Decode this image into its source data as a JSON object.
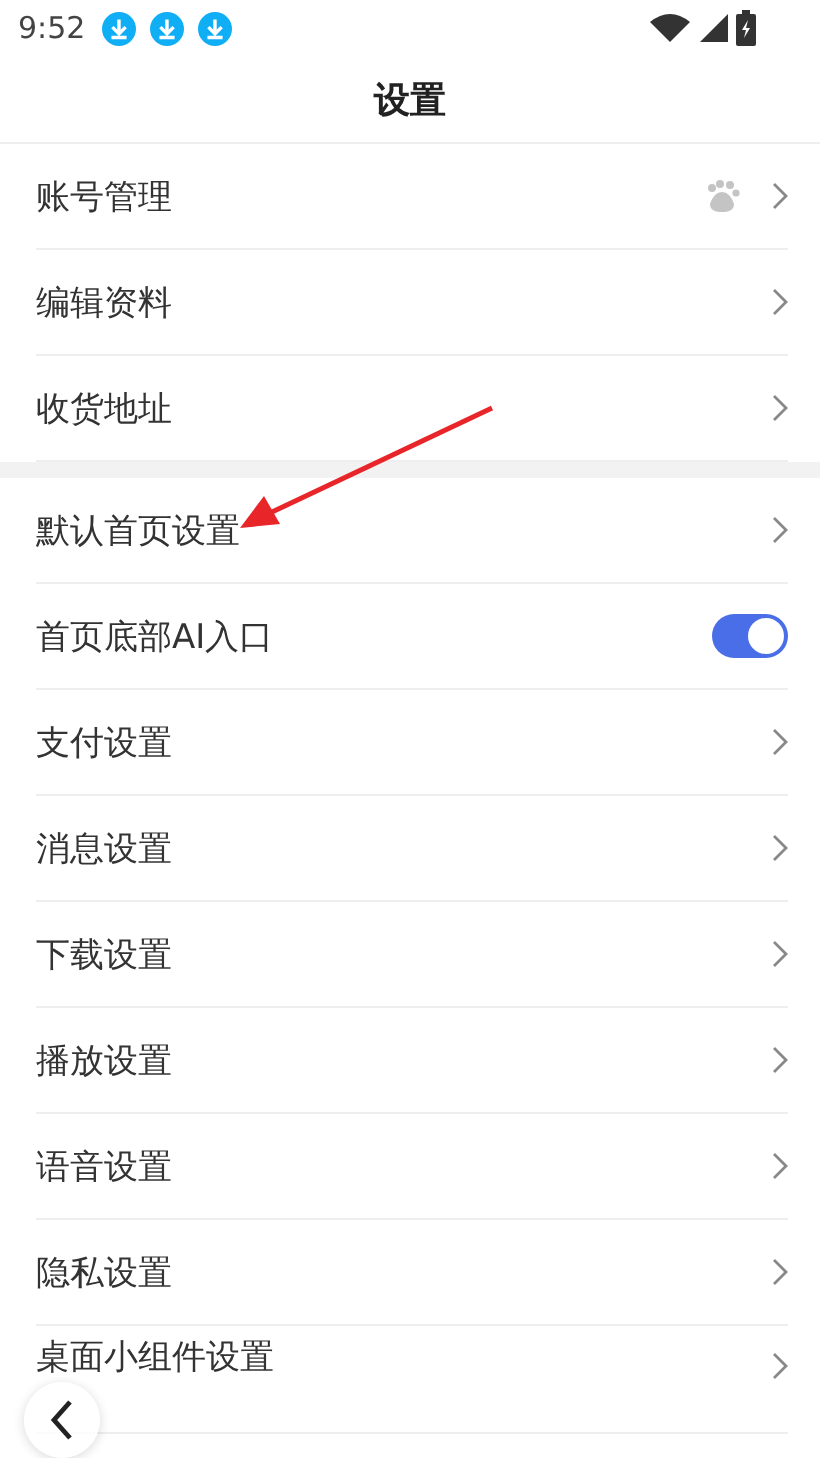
{
  "status_bar": {
    "time": "9:52",
    "notifications": [
      {
        "kind": "download"
      },
      {
        "kind": "download"
      },
      {
        "kind": "download"
      }
    ]
  },
  "title": "设置",
  "sections": [
    {
      "items": [
        {
          "label": "账号管理",
          "kind": "account"
        },
        {
          "label": "编辑资料",
          "kind": "link"
        },
        {
          "label": "收货地址",
          "kind": "link"
        }
      ]
    },
    {
      "items": [
        {
          "label": "默认首页设置",
          "kind": "link"
        },
        {
          "label": "首页底部AI入口",
          "kind": "toggle",
          "on": true
        },
        {
          "label": "支付设置",
          "kind": "link"
        },
        {
          "label": "消息设置",
          "kind": "link"
        },
        {
          "label": "下载设置",
          "kind": "link"
        },
        {
          "label": "播放设置",
          "kind": "link"
        },
        {
          "label": "语音设置",
          "kind": "link"
        },
        {
          "label": "隐私设置",
          "kind": "link"
        },
        {
          "label": "桌面小组件设置",
          "kind": "link"
        }
      ]
    }
  ]
}
